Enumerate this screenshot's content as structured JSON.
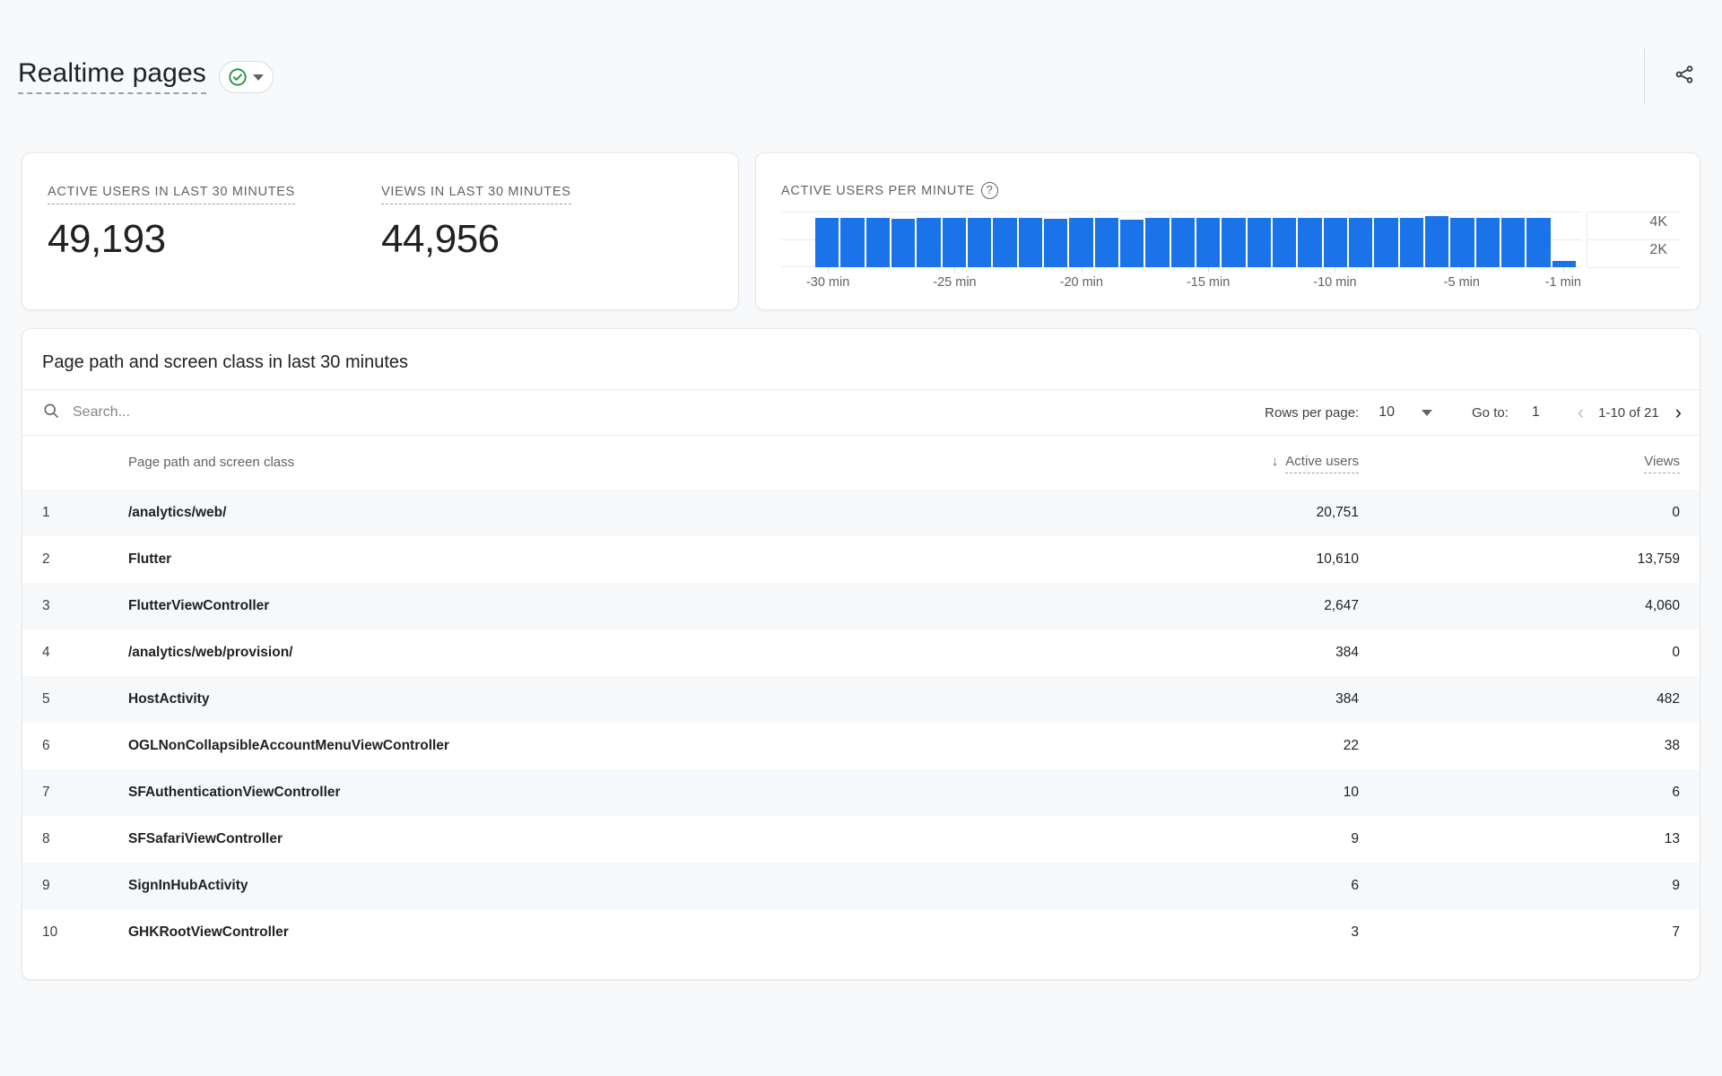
{
  "header": {
    "title": "Realtime pages",
    "status_icon": "check-circle-icon",
    "status_color": "#1e8e3e",
    "dropdown_icon": "chevron-down-icon",
    "share_icon": "share-icon"
  },
  "metrics": [
    {
      "label": "ACTIVE USERS IN LAST 30 MINUTES",
      "value": "49,193"
    },
    {
      "label": "VIEWS IN LAST 30 MINUTES",
      "value": "44,956"
    }
  ],
  "realtime_chart": {
    "label": "ACTIVE USERS PER MINUTE",
    "help_icon": "help-circle-icon",
    "accent_color": "#1a73e8"
  },
  "chart_data": {
    "type": "bar",
    "title": "ACTIVE USERS PER MINUTE",
    "xlabel": "",
    "ylabel": "",
    "ylim": [
      0,
      5000
    ],
    "grid": true,
    "legend": "none",
    "ytick_labels": [
      "4K",
      "2K"
    ],
    "ytick_values": [
      4000,
      2000
    ],
    "xtick_labels": [
      "-30 min",
      "-25 min",
      "-20 min",
      "-15 min",
      "-10 min",
      "-5 min",
      "-1 min"
    ],
    "xtick_positions": [
      0,
      5,
      10,
      15,
      20,
      25,
      29
    ],
    "categories": [
      "-30",
      "-29",
      "-28",
      "-27",
      "-26",
      "-25",
      "-24",
      "-23",
      "-22",
      "-21",
      "-20",
      "-19",
      "-18",
      "-17",
      "-16",
      "-15",
      "-14",
      "-13",
      "-12",
      "-11",
      "-10",
      "-9",
      "-8",
      "-7",
      "-6",
      "-5",
      "-4",
      "-3",
      "-2",
      "-1"
    ],
    "values": [
      4450,
      4400,
      4420,
      4380,
      4400,
      4430,
      4400,
      4420,
      4400,
      4390,
      4420,
      4400,
      4300,
      4420,
      4400,
      4410,
      4400,
      4420,
      4400,
      4410,
      4420,
      4400,
      4430,
      4400,
      4600,
      4420,
      4400,
      4420,
      4430,
      600
    ]
  },
  "table": {
    "title": "Page path and screen class in last 30 minutes",
    "search_placeholder": "Search...",
    "search_value": "",
    "search_icon": "search-icon",
    "pagination": {
      "rows_per_page_label": "Rows per page:",
      "rows_per_page_value": "10",
      "rows_per_page_icon": "chevron-down-icon",
      "goto_label": "Go to:",
      "goto_value": "1",
      "prev_icon": "chevron-left-icon",
      "next_icon": "chevron-right-icon",
      "range": "1-10 of 21"
    },
    "columns": {
      "name": "Page path and screen class",
      "active_users": "Active users",
      "views": "Views",
      "sort_icon": "arrow-down-icon",
      "sorted_by": "Active users"
    },
    "rows": [
      {
        "index": "1",
        "name": "/analytics/web/",
        "active_users": "20,751",
        "views": "0"
      },
      {
        "index": "2",
        "name": "Flutter",
        "active_users": "10,610",
        "views": "13,759"
      },
      {
        "index": "3",
        "name": "FlutterViewController",
        "active_users": "2,647",
        "views": "4,060"
      },
      {
        "index": "4",
        "name": "/analytics/web/provision/",
        "active_users": "384",
        "views": "0"
      },
      {
        "index": "5",
        "name": "HostActivity",
        "active_users": "384",
        "views": "482"
      },
      {
        "index": "6",
        "name": "OGLNonCollapsibleAccountMenuViewController",
        "active_users": "22",
        "views": "38"
      },
      {
        "index": "7",
        "name": "SFAuthenticationViewController",
        "active_users": "10",
        "views": "6"
      },
      {
        "index": "8",
        "name": "SFSafariViewController",
        "active_users": "9",
        "views": "13"
      },
      {
        "index": "9",
        "name": "SignInHubActivity",
        "active_users": "6",
        "views": "9"
      },
      {
        "index": "10",
        "name": "GHKRootViewController",
        "active_users": "3",
        "views": "7"
      }
    ]
  }
}
